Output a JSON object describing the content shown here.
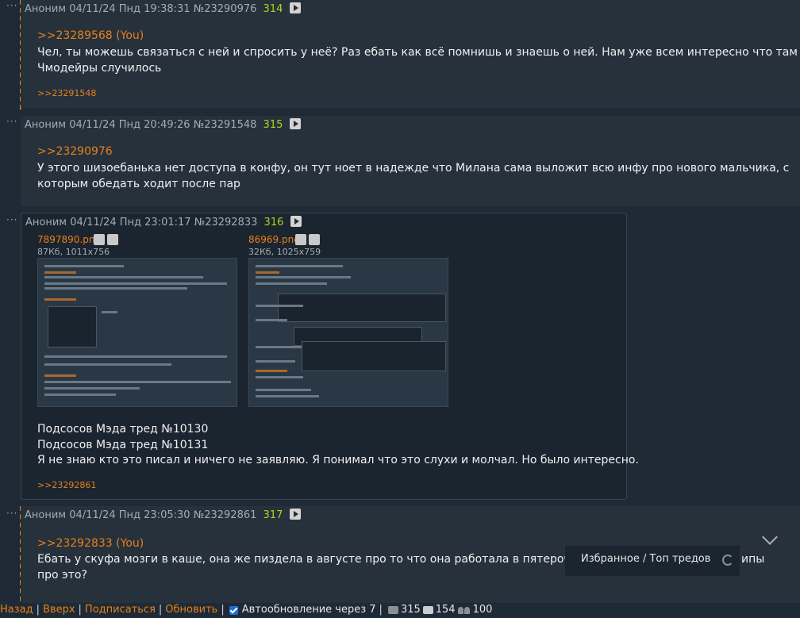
{
  "posts": [
    {
      "author": "Аноним",
      "date": "04/11/24 Пнд 19:38:31",
      "number": "№23290976",
      "count": "314",
      "reply_to": ">>23289568 (You)",
      "lines": [
        "Чел, ты можешь связаться с ней и спросить у неё? Раз ебать как всё помнишь и знаешь о ней. Нам уже всем интересно что там у",
        "Чмодейры случилось"
      ],
      "replies": ">>23291548"
    },
    {
      "author": "Аноним",
      "date": "04/11/24 Пнд 20:49:26",
      "number": "№23291548",
      "count": "315",
      "reply_to": ">>23290976",
      "lines": [
        "У этого шизоебанька нет доступа в конфу, он тут ноет в надежде что Милана сама выложит всю инфу про нового мальчика, с",
        "которым обедать ходит после пар"
      ],
      "replies": ""
    },
    {
      "author": "Аноним",
      "date": "04/11/24 Пнд 23:01:17",
      "number": "№23292833",
      "count": "316",
      "files": [
        {
          "name": "7897890.png",
          "info": "87Кб, 1011x756"
        },
        {
          "name": "86969.png",
          "info": "32Кб, 1025x759"
        }
      ],
      "lines": [
        "Подсосов Мэда тред №10130",
        "Подсосов Мэда тред №10131",
        "Я не знаю кто это писал и ничего не заявляю. Я понимал что это слухи и молчал. Но было интересно."
      ],
      "replies": ">>23292861"
    },
    {
      "author": "Аноним",
      "date": "04/11/24 Пнд 23:05:30",
      "number": "№23292861",
      "count": "317",
      "reply_to": ">>23292833 (You)",
      "lines": [
        "Ебать у скуфа мозги в каше, она же пиздела в августе про то что она работала в пятерочке и",
        "про это?"
      ],
      "line_tail": "ипы",
      "replies": ""
    }
  ],
  "overlay": {
    "favorites_label": "Избранное / Топ тредов"
  },
  "bottombar": {
    "back": "Назад",
    "top": "Вверх",
    "subscribe": "Подписаться",
    "refresh": "Обновить",
    "autorefresh": "Автообновление через 7",
    "posts_count": "315",
    "images_count": "154",
    "users_count": "100"
  },
  "colors": {
    "accent": "#e8801a",
    "count_green": "#a8d81e",
    "background": "#1e2a36"
  }
}
